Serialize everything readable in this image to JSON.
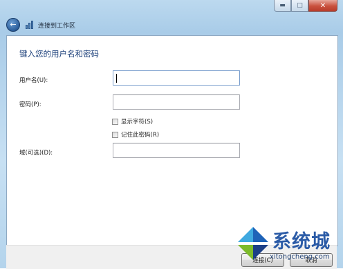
{
  "window": {
    "caption_buttons": {
      "minimize_icon": "minimize-icon",
      "maximize_icon": "maximize-icon",
      "close_icon": "close-icon"
    },
    "nav": {
      "back_icon": "back-arrow-icon",
      "title": "连接到工作区"
    }
  },
  "form": {
    "heading": "键入您的用户名和密码",
    "username_label": "用户名(U):",
    "username_value": "",
    "password_label": "密码(P):",
    "password_value": "",
    "show_chars_label": "显示字符(S)",
    "show_chars_checked": false,
    "remember_label": "记住此密码(R)",
    "remember_checked": false,
    "domain_label": "域(可选)(D):",
    "domain_value": ""
  },
  "footer": {
    "ok_label": "连接(C)",
    "cancel_label": "取消"
  },
  "watermark": {
    "brand": "系统城",
    "url": "xitongcheng.com",
    "colors": {
      "blue": "#1e63b8",
      "green": "#7dbb2a",
      "cyan": "#3fa9e0",
      "navy": "#1c3f86"
    }
  }
}
